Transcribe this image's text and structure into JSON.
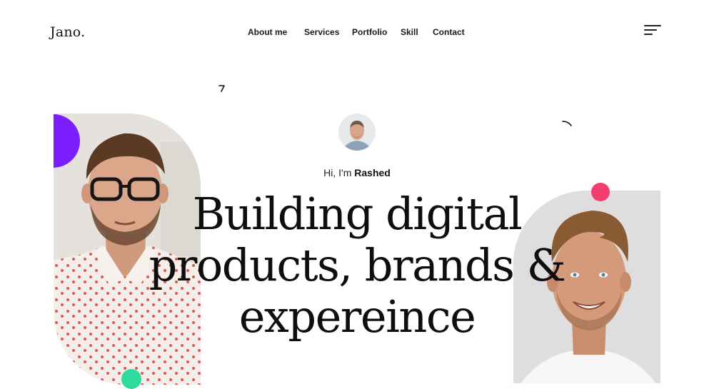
{
  "brand": {
    "logo": "Jano."
  },
  "nav": {
    "items": [
      {
        "label": "About me"
      },
      {
        "label": "Services"
      },
      {
        "label": "Portfolio"
      },
      {
        "label": "Skill"
      },
      {
        "label": "Contact"
      }
    ],
    "menu_icon": "hamburger-menu-icon"
  },
  "hero": {
    "greeting_prefix": "Hi, I'm ",
    "greeting_name": "Rashed",
    "headline_lines": [
      "Building digital",
      "products, brands &",
      "expereince"
    ]
  },
  "colors": {
    "accent_purple": "#7b1fff",
    "accent_pink": "#f43f6e",
    "accent_green": "#2ddc9c",
    "text_dark": "#111111"
  }
}
